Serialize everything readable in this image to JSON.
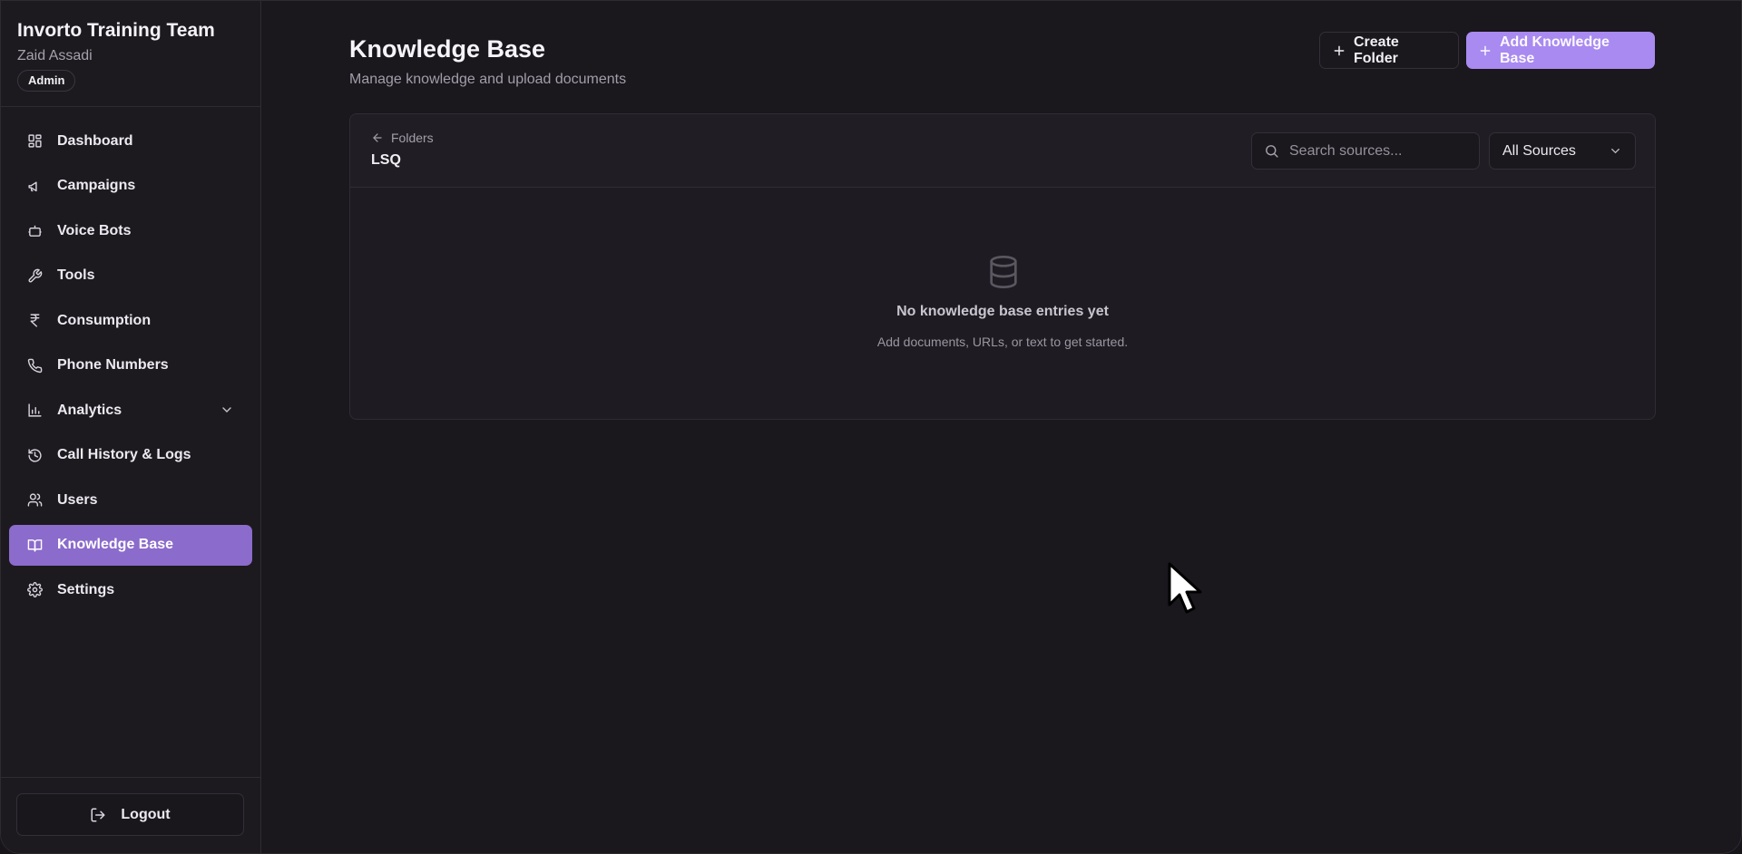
{
  "sidebar": {
    "org_name": "Invorto Training Team",
    "user_name": "Zaid Assadi",
    "role": "Admin",
    "items": [
      {
        "label": "Dashboard",
        "icon": "dashboard-icon"
      },
      {
        "label": "Campaigns",
        "icon": "megaphone-icon"
      },
      {
        "label": "Voice Bots",
        "icon": "bot-icon"
      },
      {
        "label": "Tools",
        "icon": "wrench-icon"
      },
      {
        "label": "Consumption",
        "icon": "rupee-icon"
      },
      {
        "label": "Phone Numbers",
        "icon": "phone-icon"
      },
      {
        "label": "Analytics",
        "icon": "bar-chart-icon",
        "expandable": true
      },
      {
        "label": "Call History & Logs",
        "icon": "history-icon"
      },
      {
        "label": "Users",
        "icon": "users-icon"
      },
      {
        "label": "Knowledge Base",
        "icon": "book-open-icon",
        "active": true
      },
      {
        "label": "Settings",
        "icon": "gear-icon"
      }
    ],
    "logout_label": "Logout"
  },
  "header": {
    "title": "Knowledge Base",
    "subtitle": "Manage knowledge and upload documents",
    "create_folder_label": "Create Folder",
    "add_kb_label": "Add Knowledge Base"
  },
  "folder_view": {
    "back_label": "Folders",
    "folder_name": "LSQ",
    "search_placeholder": "Search sources...",
    "source_filter": "All Sources",
    "empty_title": "No knowledge base entries yet",
    "empty_subtitle": "Add documents, URLs, or text to get started."
  },
  "colors": {
    "background": "#1a171d",
    "sidebar": "#1c1a1f",
    "accent": "#a98af0",
    "active_nav": "#8b6bcb"
  }
}
